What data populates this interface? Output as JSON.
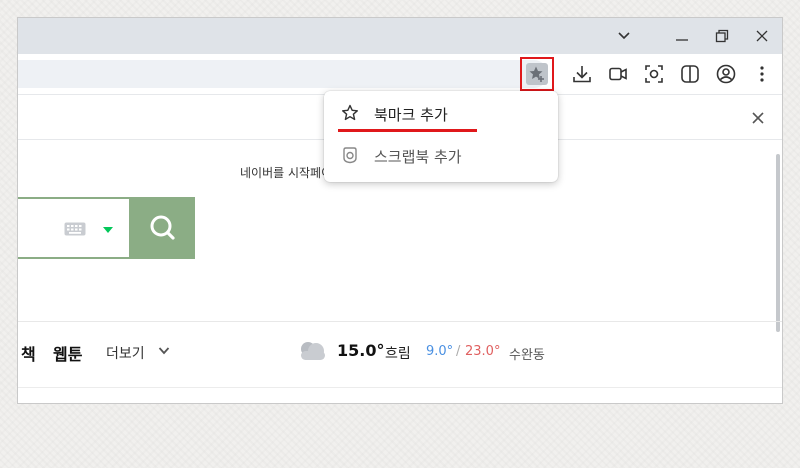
{
  "window": {
    "tab_dropdown_icon": "chevron-down-icon",
    "minimize_icon": "minimize-icon",
    "restore_icon": "restore-icon",
    "close_icon": "close-icon"
  },
  "toolbar": {
    "icons": [
      "bookmark-star-icon",
      "download-icon",
      "capture-video-icon",
      "screenshot-icon",
      "split-view-icon",
      "profile-icon",
      "more-menu-icon"
    ]
  },
  "bookmark_menu": {
    "items": [
      {
        "label": "북마크 추가",
        "icon": "star-outline-icon"
      },
      {
        "label": "스크랩북 추가",
        "icon": "scrapbook-icon"
      }
    ]
  },
  "page": {
    "start_text": "네이버를 시작페이지로",
    "nav": {
      "links": [
        "책",
        "웹툰"
      ],
      "more_label": "더보기"
    },
    "weather": {
      "temperature": "15.0°",
      "condition": "흐림",
      "low": "9.0°",
      "separator": "/",
      "high": "23.0°",
      "location": "수완동"
    }
  },
  "colors": {
    "highlight": "#e0181b",
    "search_green": "#8bad85",
    "low_temp": "#4a90e2",
    "high_temp": "#e06060"
  }
}
